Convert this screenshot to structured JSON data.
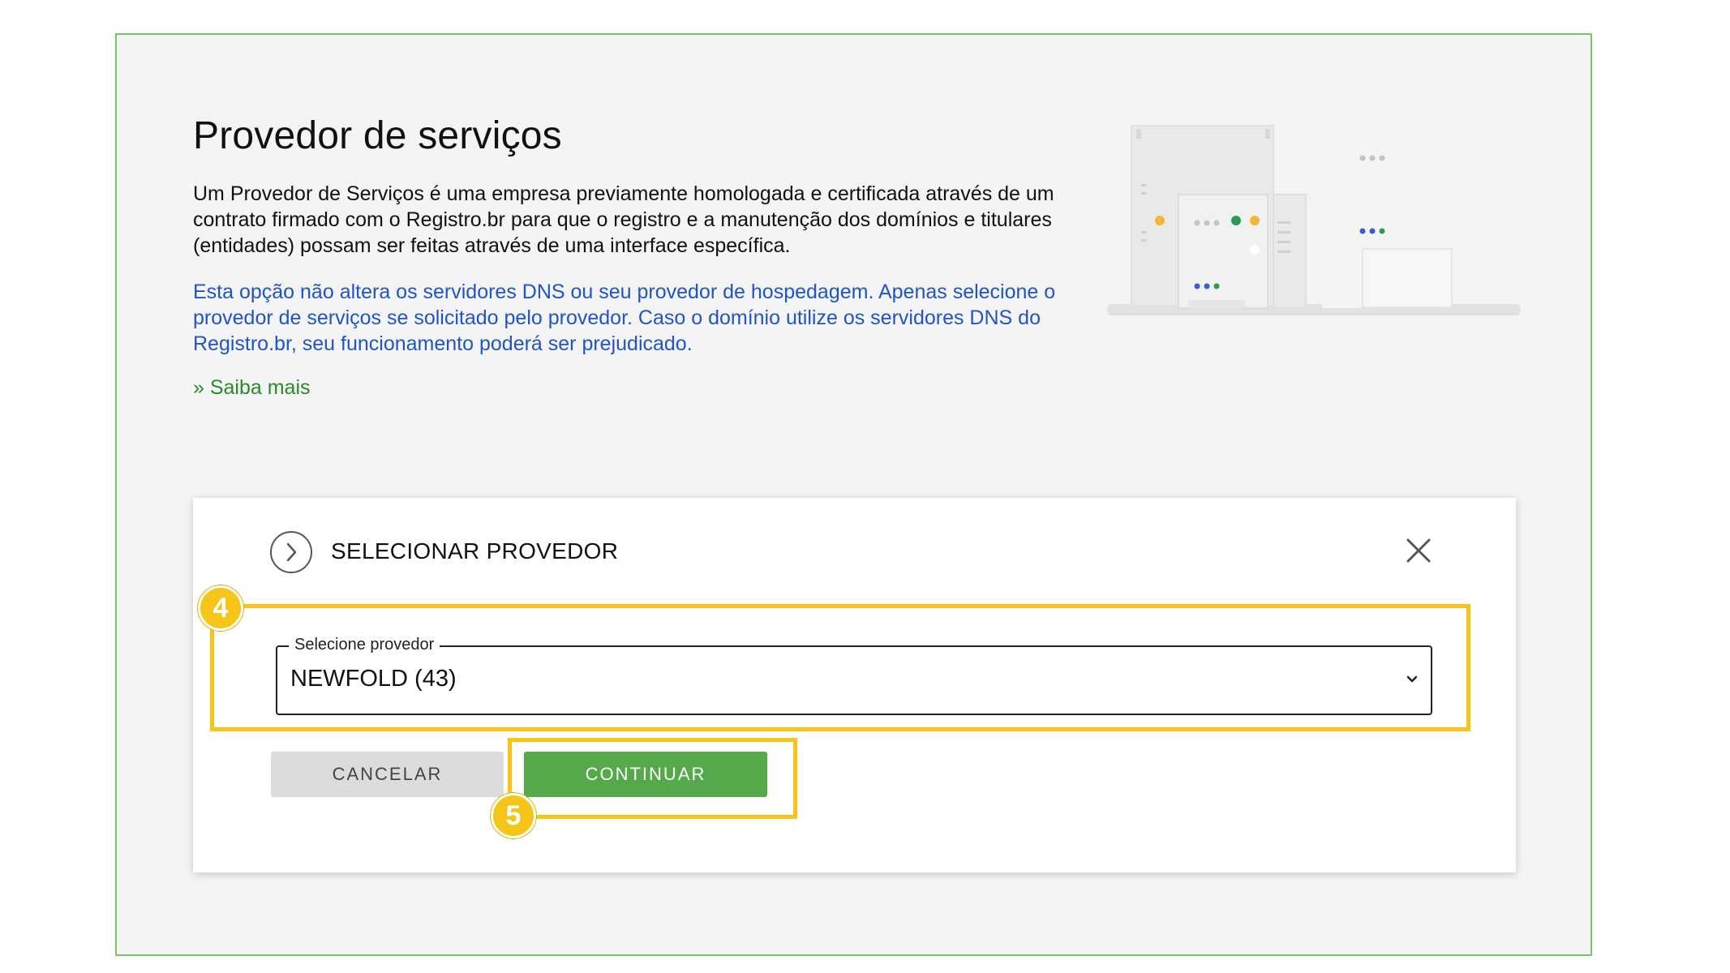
{
  "page": {
    "title": "Provedor de serviços",
    "intro": "Um Provedor de Serviços é uma empresa previamente homologada e certificada através de um contrato firmado com o Registro.br para que o registro e a manutenção dos domínios e titulares (entidades) possam ser feitas através de uma interface específica.",
    "warning": "Esta opção não altera os servidores DNS ou seu provedor de hospedagem. Apenas selecione o provedor de serviços se solicitado pelo provedor. Caso o domínio utilize os servidores DNS do Registro.br, seu funcionamento poderá ser prejudicado.",
    "learn_more": "» Saiba mais"
  },
  "modal": {
    "title": "SELECIONAR PROVEDOR",
    "select_label": "Selecione provedor",
    "select_value": "NEWFOLD (43)",
    "cancel_label": "CANCELAR",
    "continue_label": "CONTINUAR"
  },
  "annotations": {
    "step_4": "4",
    "step_5": "5"
  },
  "icons": {
    "header": "chevron-right-circle-icon",
    "close": "close-icon",
    "select": "chevron-down-icon"
  },
  "colors": {
    "accent_green": "#55a94a",
    "link_blue": "#1f55c4",
    "link_green": "#2a8a2a",
    "highlight_yellow": "#f5c518",
    "frame_border": "#7cc26a"
  }
}
